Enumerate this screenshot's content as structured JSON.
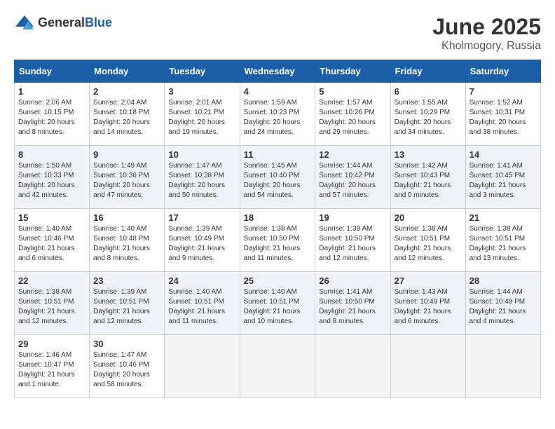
{
  "header": {
    "logo_general": "General",
    "logo_blue": "Blue",
    "month": "June 2025",
    "location": "Kholmogory, Russia"
  },
  "weekdays": [
    "Sunday",
    "Monday",
    "Tuesday",
    "Wednesday",
    "Thursday",
    "Friday",
    "Saturday"
  ],
  "weeks": [
    [
      {
        "day": 1,
        "sunrise": "2:06 AM",
        "sunset": "10:15 PM",
        "daylight": "20 hours and 8 minutes."
      },
      {
        "day": 2,
        "sunrise": "2:04 AM",
        "sunset": "10:18 PM",
        "daylight": "20 hours and 14 minutes."
      },
      {
        "day": 3,
        "sunrise": "2:01 AM",
        "sunset": "10:21 PM",
        "daylight": "20 hours and 19 minutes."
      },
      {
        "day": 4,
        "sunrise": "1:59 AM",
        "sunset": "10:23 PM",
        "daylight": "20 hours and 24 minutes."
      },
      {
        "day": 5,
        "sunrise": "1:57 AM",
        "sunset": "10:26 PM",
        "daylight": "20 hours and 29 minutes."
      },
      {
        "day": 6,
        "sunrise": "1:55 AM",
        "sunset": "10:29 PM",
        "daylight": "20 hours and 34 minutes."
      },
      {
        "day": 7,
        "sunrise": "1:52 AM",
        "sunset": "10:31 PM",
        "daylight": "20 hours and 38 minutes."
      }
    ],
    [
      {
        "day": 8,
        "sunrise": "1:50 AM",
        "sunset": "10:33 PM",
        "daylight": "20 hours and 42 minutes."
      },
      {
        "day": 9,
        "sunrise": "1:49 AM",
        "sunset": "10:36 PM",
        "daylight": "20 hours and 47 minutes."
      },
      {
        "day": 10,
        "sunrise": "1:47 AM",
        "sunset": "10:38 PM",
        "daylight": "20 hours and 50 minutes."
      },
      {
        "day": 11,
        "sunrise": "1:45 AM",
        "sunset": "10:40 PM",
        "daylight": "20 hours and 54 minutes."
      },
      {
        "day": 12,
        "sunrise": "1:44 AM",
        "sunset": "10:42 PM",
        "daylight": "20 hours and 57 minutes."
      },
      {
        "day": 13,
        "sunrise": "1:42 AM",
        "sunset": "10:43 PM",
        "daylight": "21 hours and 0 minutes."
      },
      {
        "day": 14,
        "sunrise": "1:41 AM",
        "sunset": "10:45 PM",
        "daylight": "21 hours and 3 minutes."
      }
    ],
    [
      {
        "day": 15,
        "sunrise": "1:40 AM",
        "sunset": "10:46 PM",
        "daylight": "21 hours and 6 minutes."
      },
      {
        "day": 16,
        "sunrise": "1:40 AM",
        "sunset": "10:48 PM",
        "daylight": "21 hours and 8 minutes."
      },
      {
        "day": 17,
        "sunrise": "1:39 AM",
        "sunset": "10:49 PM",
        "daylight": "21 hours and 9 minutes."
      },
      {
        "day": 18,
        "sunrise": "1:38 AM",
        "sunset": "10:50 PM",
        "daylight": "21 hours and 11 minutes."
      },
      {
        "day": 19,
        "sunrise": "1:38 AM",
        "sunset": "10:50 PM",
        "daylight": "21 hours and 12 minutes."
      },
      {
        "day": 20,
        "sunrise": "1:38 AM",
        "sunset": "10:51 PM",
        "daylight": "21 hours and 12 minutes."
      },
      {
        "day": 21,
        "sunrise": "1:38 AM",
        "sunset": "10:51 PM",
        "daylight": "21 hours and 13 minutes."
      }
    ],
    [
      {
        "day": 22,
        "sunrise": "1:38 AM",
        "sunset": "10:51 PM",
        "daylight": "21 hours and 12 minutes."
      },
      {
        "day": 23,
        "sunrise": "1:39 AM",
        "sunset": "10:51 PM",
        "daylight": "21 hours and 12 minutes."
      },
      {
        "day": 24,
        "sunrise": "1:40 AM",
        "sunset": "10:51 PM",
        "daylight": "21 hours and 11 minutes."
      },
      {
        "day": 25,
        "sunrise": "1:40 AM",
        "sunset": "10:51 PM",
        "daylight": "21 hours and 10 minutes."
      },
      {
        "day": 26,
        "sunrise": "1:41 AM",
        "sunset": "10:50 PM",
        "daylight": "21 hours and 8 minutes."
      },
      {
        "day": 27,
        "sunrise": "1:43 AM",
        "sunset": "10:49 PM",
        "daylight": "21 hours and 6 minutes."
      },
      {
        "day": 28,
        "sunrise": "1:44 AM",
        "sunset": "10:48 PM",
        "daylight": "21 hours and 4 minutes."
      }
    ],
    [
      {
        "day": 29,
        "sunrise": "1:46 AM",
        "sunset": "10:47 PM",
        "daylight": "21 hours and 1 minute."
      },
      {
        "day": 30,
        "sunrise": "1:47 AM",
        "sunset": "10:46 PM",
        "daylight": "20 hours and 58 minutes."
      },
      null,
      null,
      null,
      null,
      null
    ]
  ]
}
